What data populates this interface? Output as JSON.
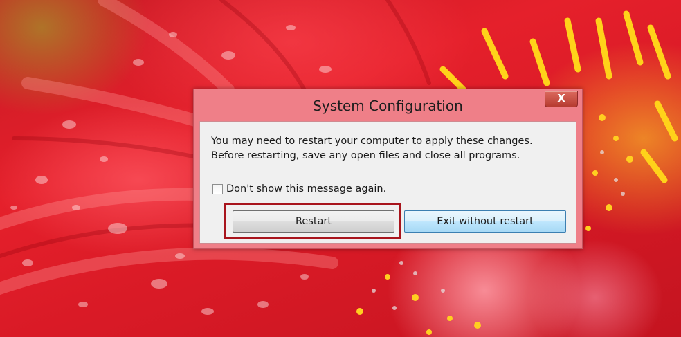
{
  "dialog": {
    "title": "System Configuration",
    "close_label": "X",
    "message_line1": "You may need to restart your computer to apply these changes.",
    "message_line2": "Before restarting, save any open files and close all programs.",
    "checkbox_label": "Don't show this message again.",
    "checkbox_checked": false,
    "restart_label": "Restart",
    "exit_label": "Exit without restart"
  },
  "colors": {
    "frame": "#ef7f88",
    "highlight": "#a8141c",
    "exit_button": "#bee6fd"
  },
  "icons": {
    "close": "close-icon"
  }
}
